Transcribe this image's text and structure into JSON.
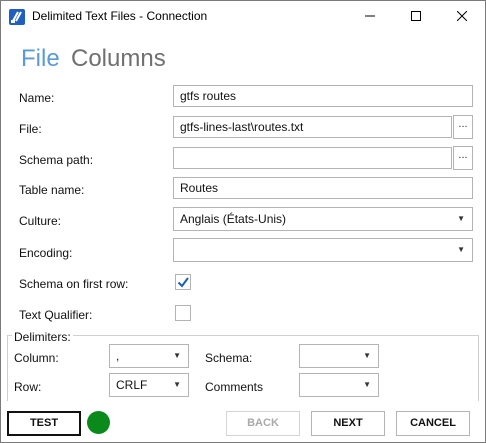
{
  "window": {
    "title": "Delimited Text Files - Connection"
  },
  "tabs": {
    "file": "File",
    "columns": "Columns"
  },
  "fields": {
    "name": {
      "label": "Name:",
      "value": "gtfs routes"
    },
    "file": {
      "label": "File:",
      "value": "gtfs-lines-last\\routes.txt",
      "browse": "..."
    },
    "schema_path": {
      "label": "Schema path:",
      "value": "",
      "browse": "..."
    },
    "table_name": {
      "label": "Table name:",
      "value": "Routes"
    },
    "culture": {
      "label": "Culture:",
      "value": "Anglais (États-Unis)"
    },
    "encoding": {
      "label": "Encoding:",
      "value": ""
    },
    "schema_first_row": {
      "label": "Schema on first row:",
      "checked": true
    },
    "text_qualifier": {
      "label": "Text Qualifier:",
      "checked": false
    }
  },
  "delimiters": {
    "title": "Delimiters:",
    "column": {
      "label": "Column:",
      "value": ","
    },
    "row": {
      "label": "Row:",
      "value": "CRLF"
    },
    "schema": {
      "label": "Schema:",
      "value": ""
    },
    "comments": {
      "label": "Comments",
      "value": ""
    }
  },
  "buttons": {
    "test": "TEST",
    "back": "BACK",
    "next": "NEXT",
    "cancel": "CANCEL"
  },
  "status": {
    "connection_ok": true,
    "color": "#0a8a1a"
  },
  "colors": {
    "accent": "#5a9bd5",
    "secondary_heading": "#707070",
    "checkmark": "#1a5fb4"
  }
}
